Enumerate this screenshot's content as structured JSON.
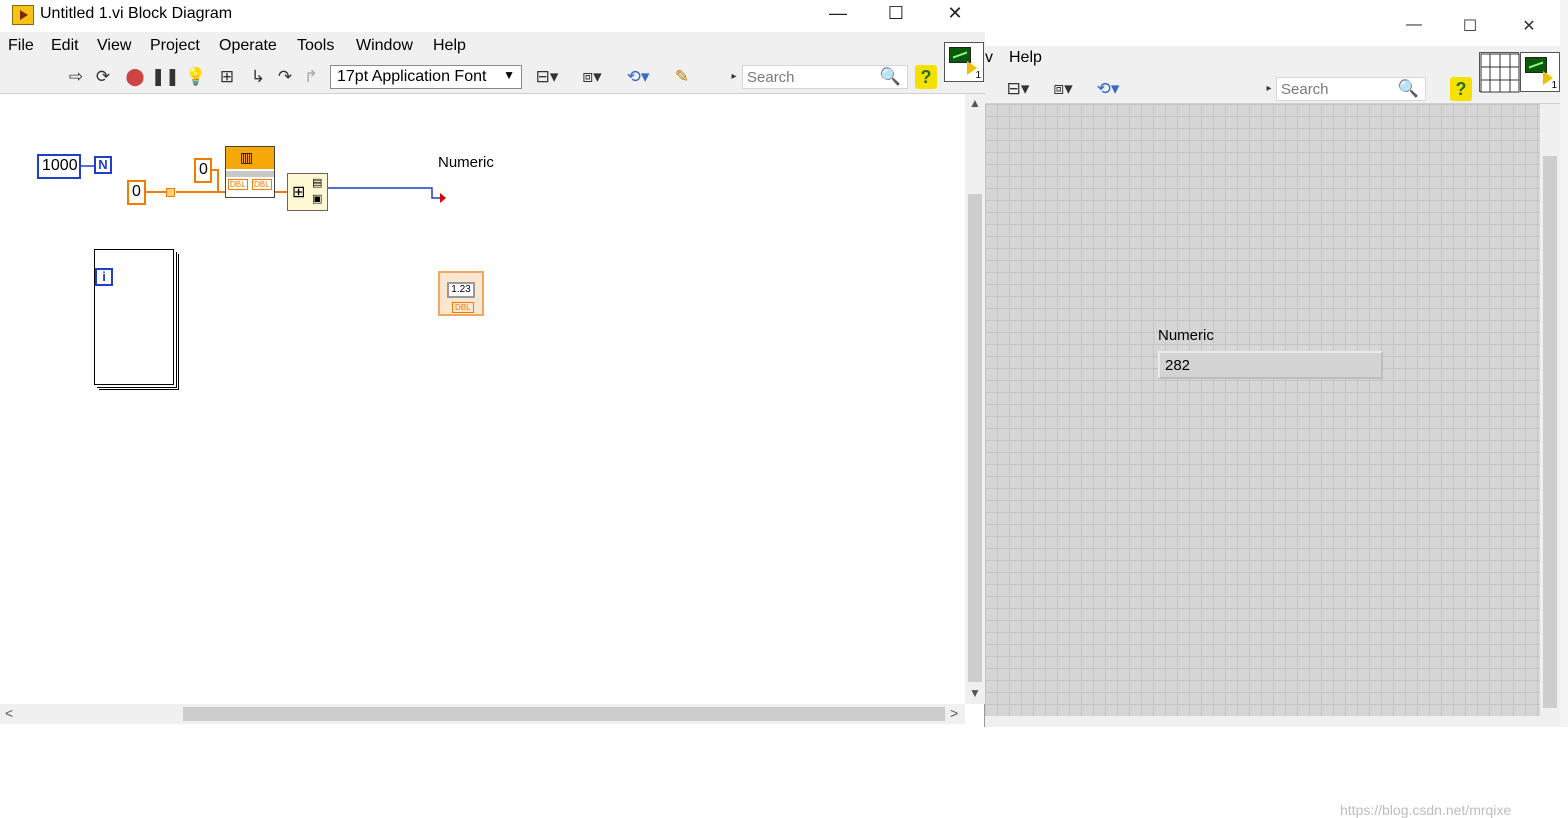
{
  "block_diagram": {
    "title": "Untitled 1.vi Block Diagram",
    "window_controls": {
      "minimize": "—",
      "maximize": "☐",
      "close": "✕"
    },
    "menu": [
      "File",
      "Edit",
      "View",
      "Project",
      "Operate",
      "Tools",
      "Window",
      "Help"
    ],
    "toolbar": {
      "font": "17pt Application Font",
      "search_placeholder": "Search"
    },
    "panel_icon_number": "1",
    "diagram": {
      "loop_count": "1000",
      "loop_count_terminal": "N",
      "iteration_terminal": "i",
      "shift_init": "0",
      "second_const": "0",
      "indicator_label": "Numeric",
      "indicator_text": "1.23",
      "indicator_type": "DBL",
      "node_type_a": "DBL",
      "node_type_b": "DBL"
    }
  },
  "front_panel": {
    "menu_visible": "Help",
    "menu_partial": "v",
    "search_placeholder": "Search",
    "panel_icon_number": "1",
    "numeric_label": "Numeric",
    "numeric_value": "282",
    "watermark": "https://blog.csdn.net/mrqixe"
  },
  "colors": {
    "integer_wire": "#1d3fc9",
    "dbl_wire": "#f17c00",
    "grid_background": "#d6d6d6"
  }
}
